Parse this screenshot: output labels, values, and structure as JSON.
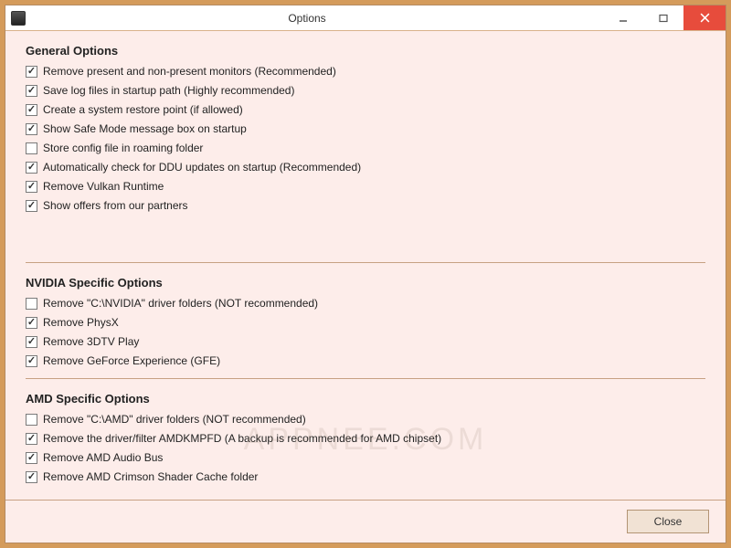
{
  "window": {
    "title": "Options",
    "close_label": "Close",
    "watermark": "APPNEE.COM"
  },
  "sections": {
    "general": {
      "title": "General Options",
      "options": [
        {
          "label": "Remove present and non-present monitors (Recommended)",
          "checked": true
        },
        {
          "label": "Save log files in startup path (Highly recommended)",
          "checked": true
        },
        {
          "label": "Create a system restore point (if allowed)",
          "checked": true
        },
        {
          "label": "Show Safe Mode message box on startup",
          "checked": true
        },
        {
          "label": "Store config file in roaming folder",
          "checked": false
        },
        {
          "label": "Automatically check for DDU updates on startup (Recommended)",
          "checked": true
        },
        {
          "label": "Remove Vulkan Runtime",
          "checked": true
        },
        {
          "label": "Show offers from our partners",
          "checked": true
        }
      ]
    },
    "nvidia": {
      "title": "NVIDIA Specific Options",
      "options": [
        {
          "label": "Remove \"C:\\NVIDIA\" driver folders (NOT recommended)",
          "checked": false
        },
        {
          "label": "Remove PhysX",
          "checked": true
        },
        {
          "label": "Remove 3DTV Play",
          "checked": true
        },
        {
          "label": "Remove GeForce Experience (GFE)",
          "checked": true
        }
      ]
    },
    "amd": {
      "title": "AMD Specific Options",
      "options": [
        {
          "label": "Remove \"C:\\AMD\" driver folders (NOT recommended)",
          "checked": false
        },
        {
          "label": "Remove the driver/filter AMDKMPFD (A backup is recommended for AMD chipset)",
          "checked": true
        },
        {
          "label": "Remove AMD Audio Bus",
          "checked": true
        },
        {
          "label": "Remove AMD Crimson Shader Cache folder",
          "checked": true
        }
      ]
    }
  }
}
